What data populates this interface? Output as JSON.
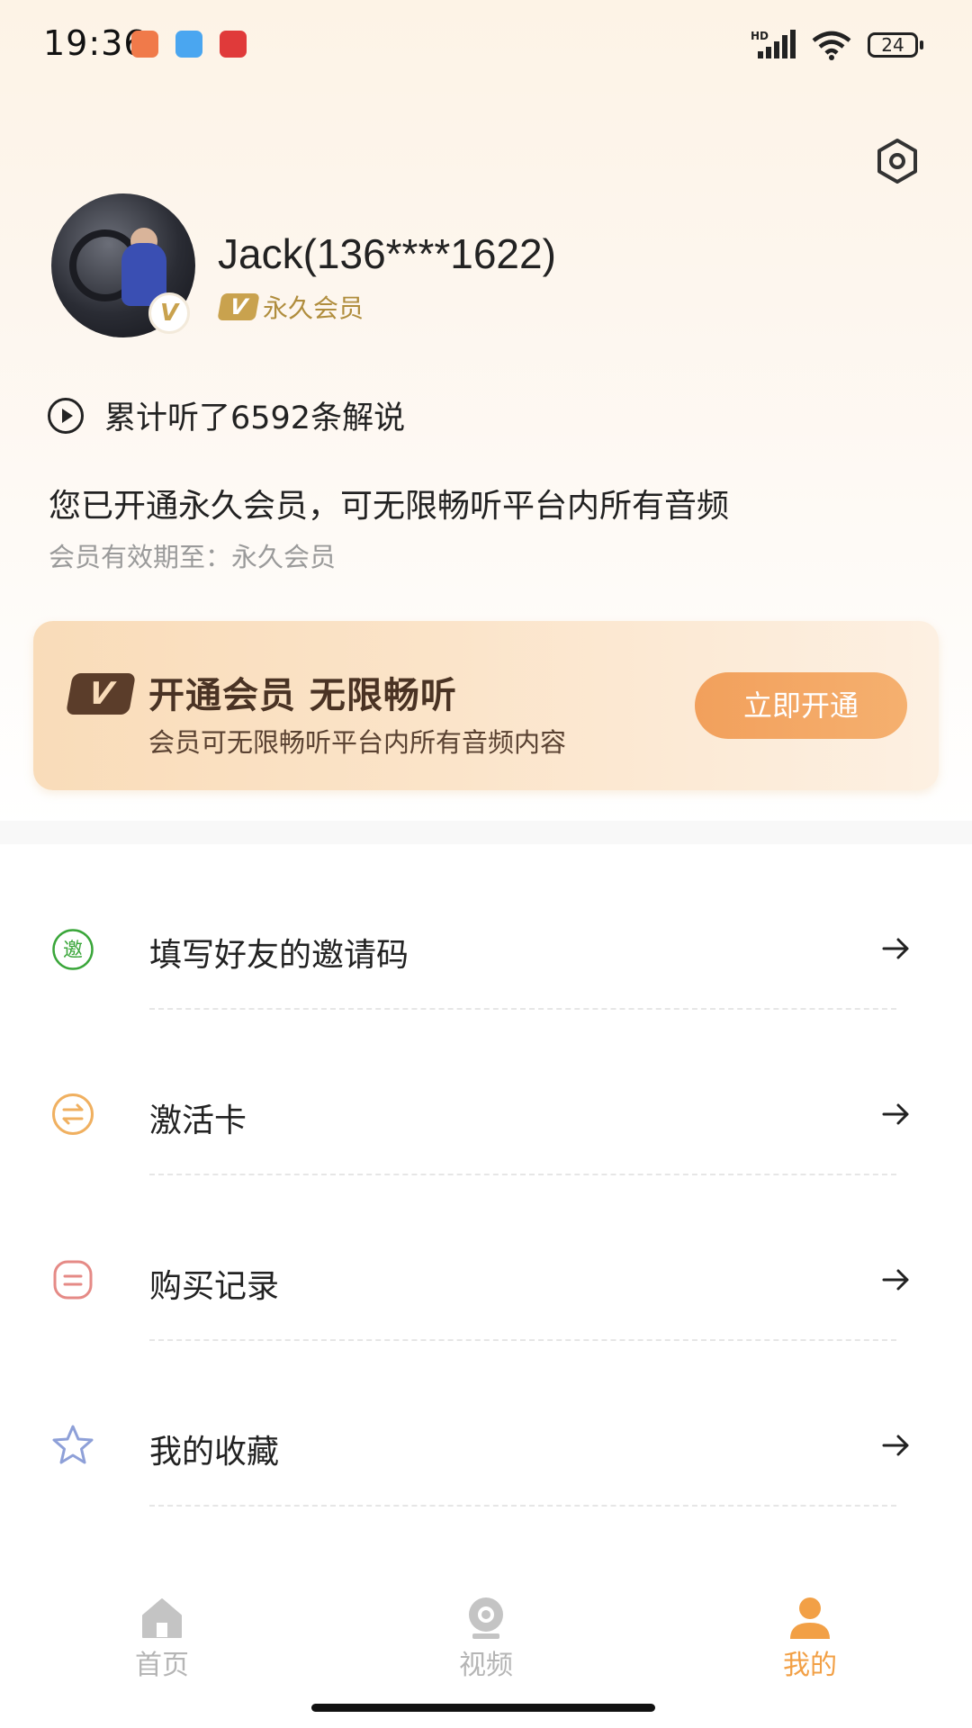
{
  "status_bar": {
    "time": "19:36",
    "network": "HD",
    "battery": "24"
  },
  "profile": {
    "username": "Jack(136****1622)",
    "vip_badge": "V",
    "vip_label": "永久会员"
  },
  "stats": {
    "listened": "累计听了6592条解说"
  },
  "membership": {
    "description": "您已开通永久会员，可无限畅听平台内所有音频",
    "validity": "会员有效期至：永久会员"
  },
  "promo": {
    "logo": "V",
    "title": "开通会员 无限畅听",
    "subtitle": "会员可无限畅听平台内所有音频内容",
    "button": "立即开通"
  },
  "menu": [
    {
      "label": "填写好友的邀请码",
      "icon": "invite-icon",
      "icon_char": "邀",
      "color": "#3aa63a"
    },
    {
      "label": "激活卡",
      "icon": "activation-card-icon",
      "color": "#f0b060"
    },
    {
      "label": "购买记录",
      "icon": "purchase-record-icon",
      "color": "#e58a86"
    },
    {
      "label": "我的收藏",
      "icon": "star-icon",
      "color": "#8ea0d8"
    }
  ],
  "tabs": [
    {
      "label": "首页",
      "icon": "home-icon",
      "active": false
    },
    {
      "label": "视频",
      "icon": "video-icon",
      "active": false
    },
    {
      "label": "我的",
      "icon": "profile-icon",
      "active": true
    }
  ],
  "colors": {
    "accent": "#f2a046",
    "gold": "#c9a24e"
  }
}
